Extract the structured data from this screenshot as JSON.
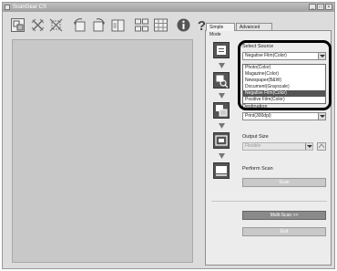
{
  "window": {
    "title": "ScanGear CS",
    "controls": {
      "minimize": "_",
      "maximize": "□",
      "close": "×"
    }
  },
  "toolbar": {
    "icons": [
      "zoom-icon",
      "crop-icon",
      "auto-crop-icon",
      "rotate-left-icon",
      "rotate-right-icon",
      "mirror-icon",
      "thumbnail-icon",
      "grid-icon",
      "info-icon",
      "help-icon"
    ]
  },
  "tabs": {
    "simple": "Simple Mode",
    "advanced": "Advanced Mode"
  },
  "source": {
    "label": "Select Source",
    "value": "Negative Film(Color)",
    "options": [
      "Photo(Color)",
      "Magazine(Color)",
      "Newspaper(B&W)",
      "Document(Grayscale)",
      "Negative Film(Color)",
      "Positive Film(Color)"
    ],
    "selected_index": 4
  },
  "destination": {
    "label": "Destination",
    "value": "Print(300dpi)"
  },
  "output_size": {
    "label": "Output Size",
    "value": "Flexible"
  },
  "perform_scan": {
    "label": "Perform Scan",
    "button": "Scan"
  },
  "bottom": {
    "multi_scan": "Multi-Scan >>",
    "exit": "Exit"
  }
}
